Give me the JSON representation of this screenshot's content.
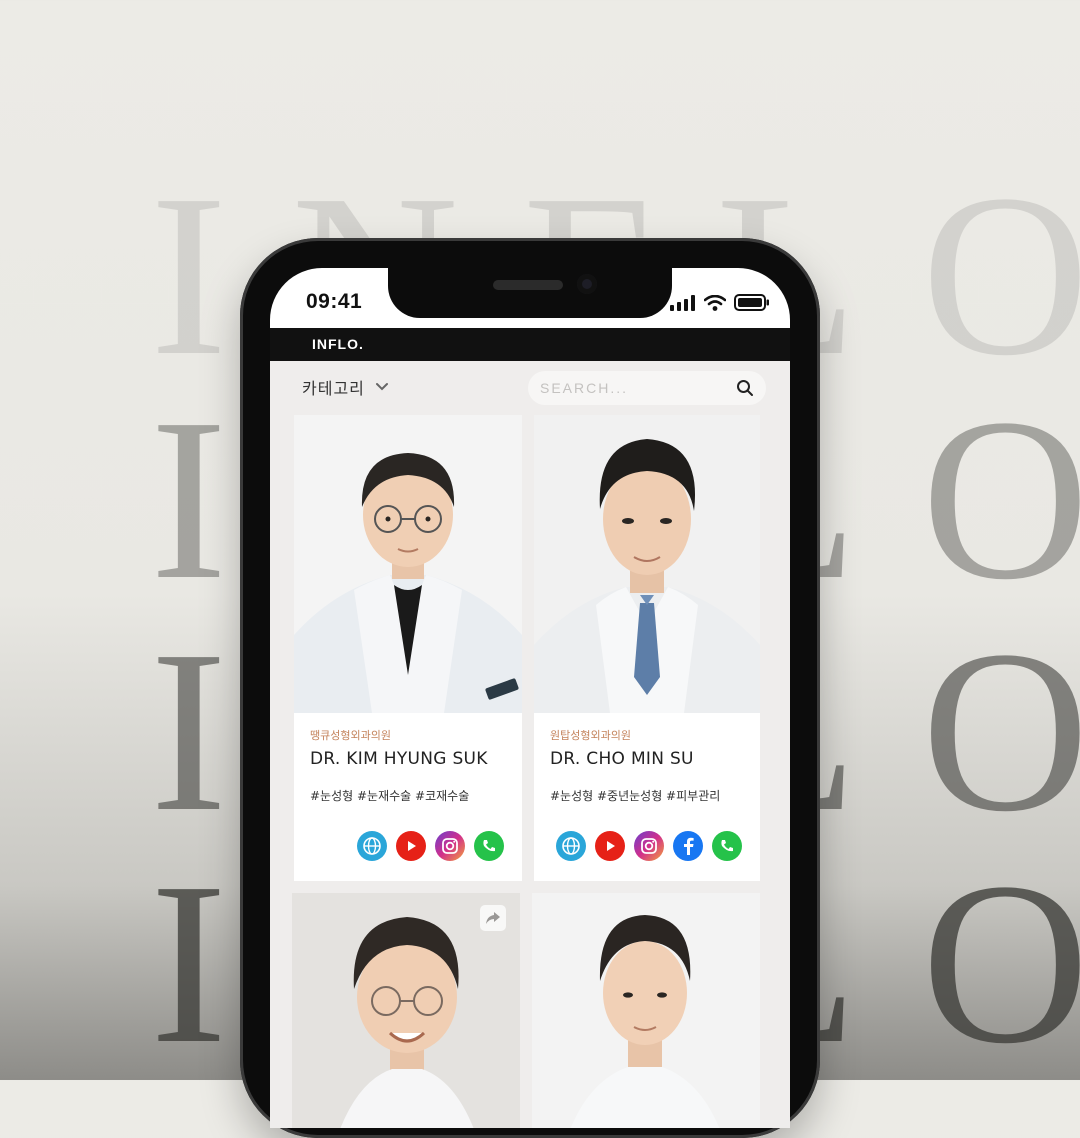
{
  "background": {
    "word": "INFLO"
  },
  "status_bar": {
    "time": "09:41"
  },
  "app": {
    "brand": "INFLO."
  },
  "filter": {
    "category_label": "카테고리"
  },
  "search": {
    "placeholder": "SEARCH..."
  },
  "doctors": [
    {
      "hospital": "땡큐성형외과의원",
      "name": "DR. KIM HYUNG SUK",
      "tags": "#눈성형 #눈재수술 #코재수술",
      "socials": [
        "globe-icon",
        "youtube-icon",
        "instagram-icon",
        "phone-icon"
      ]
    },
    {
      "hospital": "원탑성형외과의원",
      "name": "DR. CHO MIN SU",
      "tags": "#눈성형 #중년눈성형 #피부관리",
      "socials": [
        "globe-icon",
        "youtube-icon",
        "instagram-icon",
        "facebook-icon",
        "phone-icon"
      ]
    },
    {
      "hospital": "",
      "name": "",
      "tags": "",
      "socials": []
    },
    {
      "hospital": "",
      "name": "",
      "tags": "",
      "socials": []
    }
  ],
  "colors": {
    "hospital_text": "#c4835c",
    "appbar": "#111111",
    "content_bg": "#efedec",
    "globe": "#2aa6d9",
    "youtube": "#e62117",
    "facebook": "#1877f2",
    "phone": "#25c24a"
  }
}
